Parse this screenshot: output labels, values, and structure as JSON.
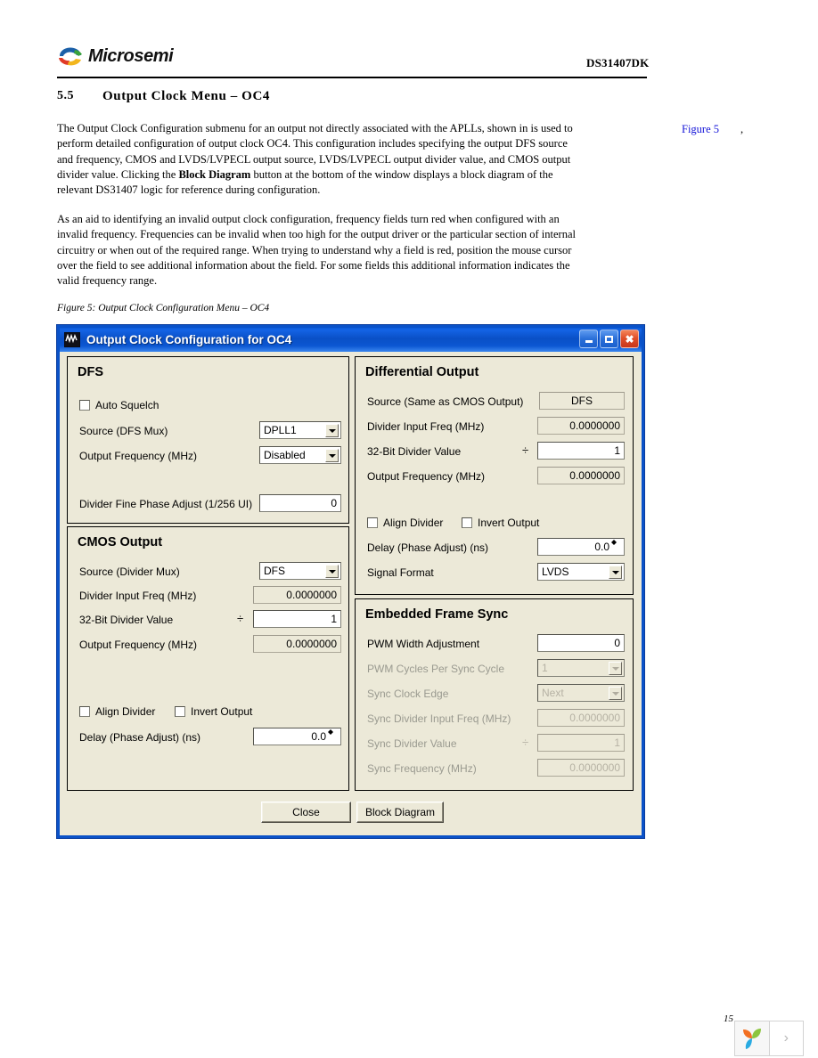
{
  "header": {
    "logo_text": "Microsemi",
    "doc_id": "DS31407DK"
  },
  "section": {
    "number": "5.5",
    "title": "Output Clock Menu – OC4"
  },
  "paragraphs": {
    "p1_a": "The Output Clock Configuration submenu for an output not directly associated with the APLLs, shown in",
    "p1_b": "is used to perform detailed configuration of output clock OC4. This configuration includes specifying the output DFS source and frequency, CMOS and LVDS/LVPECL output source, LVDS/LVPECL output divider value, and CMOS output divider value. Clicking the ",
    "p1_bold": "Block Diagram",
    "p1_c": " button at the bottom of the window displays a block diagram of the relevant DS31407 logic for reference during configuration.",
    "p2": "As an aid to identifying an invalid output clock configuration, frequency fields turn red when configured with an invalid frequency. Frequencies can be invalid when too high for the output driver or the particular section of internal circuitry or when out of the required range. When trying to understand why a field is red, position the mouse cursor over the field to see additional information about the field. For some fields this additional information indicates the valid frequency range.",
    "figure_link": "Figure 5",
    "figure_link_comma": ","
  },
  "figure_caption": "Figure 5: Output Clock Configuration Menu – OC4",
  "window": {
    "title": "Output Clock Configuration for OC4",
    "icon": "waveform-icon",
    "minimize": "minimize-icon",
    "maximize": "maximize-icon",
    "close": "close-icon"
  },
  "dfs": {
    "title": "DFS",
    "auto_squelch": "Auto Squelch",
    "source_label": "Source (DFS Mux)",
    "source_value": "DPLL1",
    "output_freq_label": "Output Frequency (MHz)",
    "output_freq_value": "Disabled",
    "fine_phase_label": "Divider Fine Phase Adjust (1/256 UI)",
    "fine_phase_value": "0"
  },
  "cmos": {
    "title": "CMOS Output",
    "source_label": "Source (Divider Mux)",
    "source_value": "DFS",
    "div_in_label": "Divider Input Freq (MHz)",
    "div_in_value": "0.0000000",
    "div_val_label": "32-Bit Divider Value",
    "div_symbol": "÷",
    "div_val_value": "1",
    "out_freq_label": "Output Frequency (MHz)",
    "out_freq_value": "0.0000000",
    "align_divider": "Align Divider",
    "invert_output": "Invert Output",
    "delay_label": "Delay (Phase Adjust) (ns)",
    "delay_value": "0.0"
  },
  "differential": {
    "title": "Differential Output",
    "source_label": "Source (Same as CMOS Output)",
    "source_value": "DFS",
    "div_in_label": "Divider Input Freq (MHz)",
    "div_in_value": "0.0000000",
    "div_val_label": "32-Bit Divider Value",
    "div_symbol": "÷",
    "div_val_value": "1",
    "out_freq_label": "Output Frequency (MHz)",
    "out_freq_value": "0.0000000",
    "align_divider": "Align Divider",
    "invert_output": "Invert Output",
    "delay_label": "Delay (Phase Adjust) (ns)",
    "delay_value": "0.0",
    "signal_format_label": "Signal Format",
    "signal_format_value": "LVDS"
  },
  "frame_sync": {
    "title": "Embedded Frame Sync",
    "pwm_width_label": "PWM Width Adjustment",
    "pwm_width_value": "0",
    "pwm_cycles_label": "PWM Cycles Per Sync Cycle",
    "pwm_cycles_value": "1",
    "sync_edge_label": "Sync Clock Edge",
    "sync_edge_value": "Next",
    "sync_div_in_label": "Sync Divider Input Freq (MHz)",
    "sync_div_in_value": "0.0000000",
    "sync_div_val_label": "Sync Divider Value",
    "sync_div_symbol": "÷",
    "sync_div_val_value": "1",
    "sync_freq_label": "Sync Frequency (MHz)",
    "sync_freq_value": "0.0000000"
  },
  "buttons": {
    "close": "Close",
    "block_diagram": "Block Diagram"
  },
  "footer": {
    "page_number": "15",
    "next_arrow": "›"
  },
  "colors": {
    "titlebar": "#0a52c8",
    "dialog_face": "#ece9d8",
    "link": "#1414d8",
    "close_button": "#e0502a"
  }
}
